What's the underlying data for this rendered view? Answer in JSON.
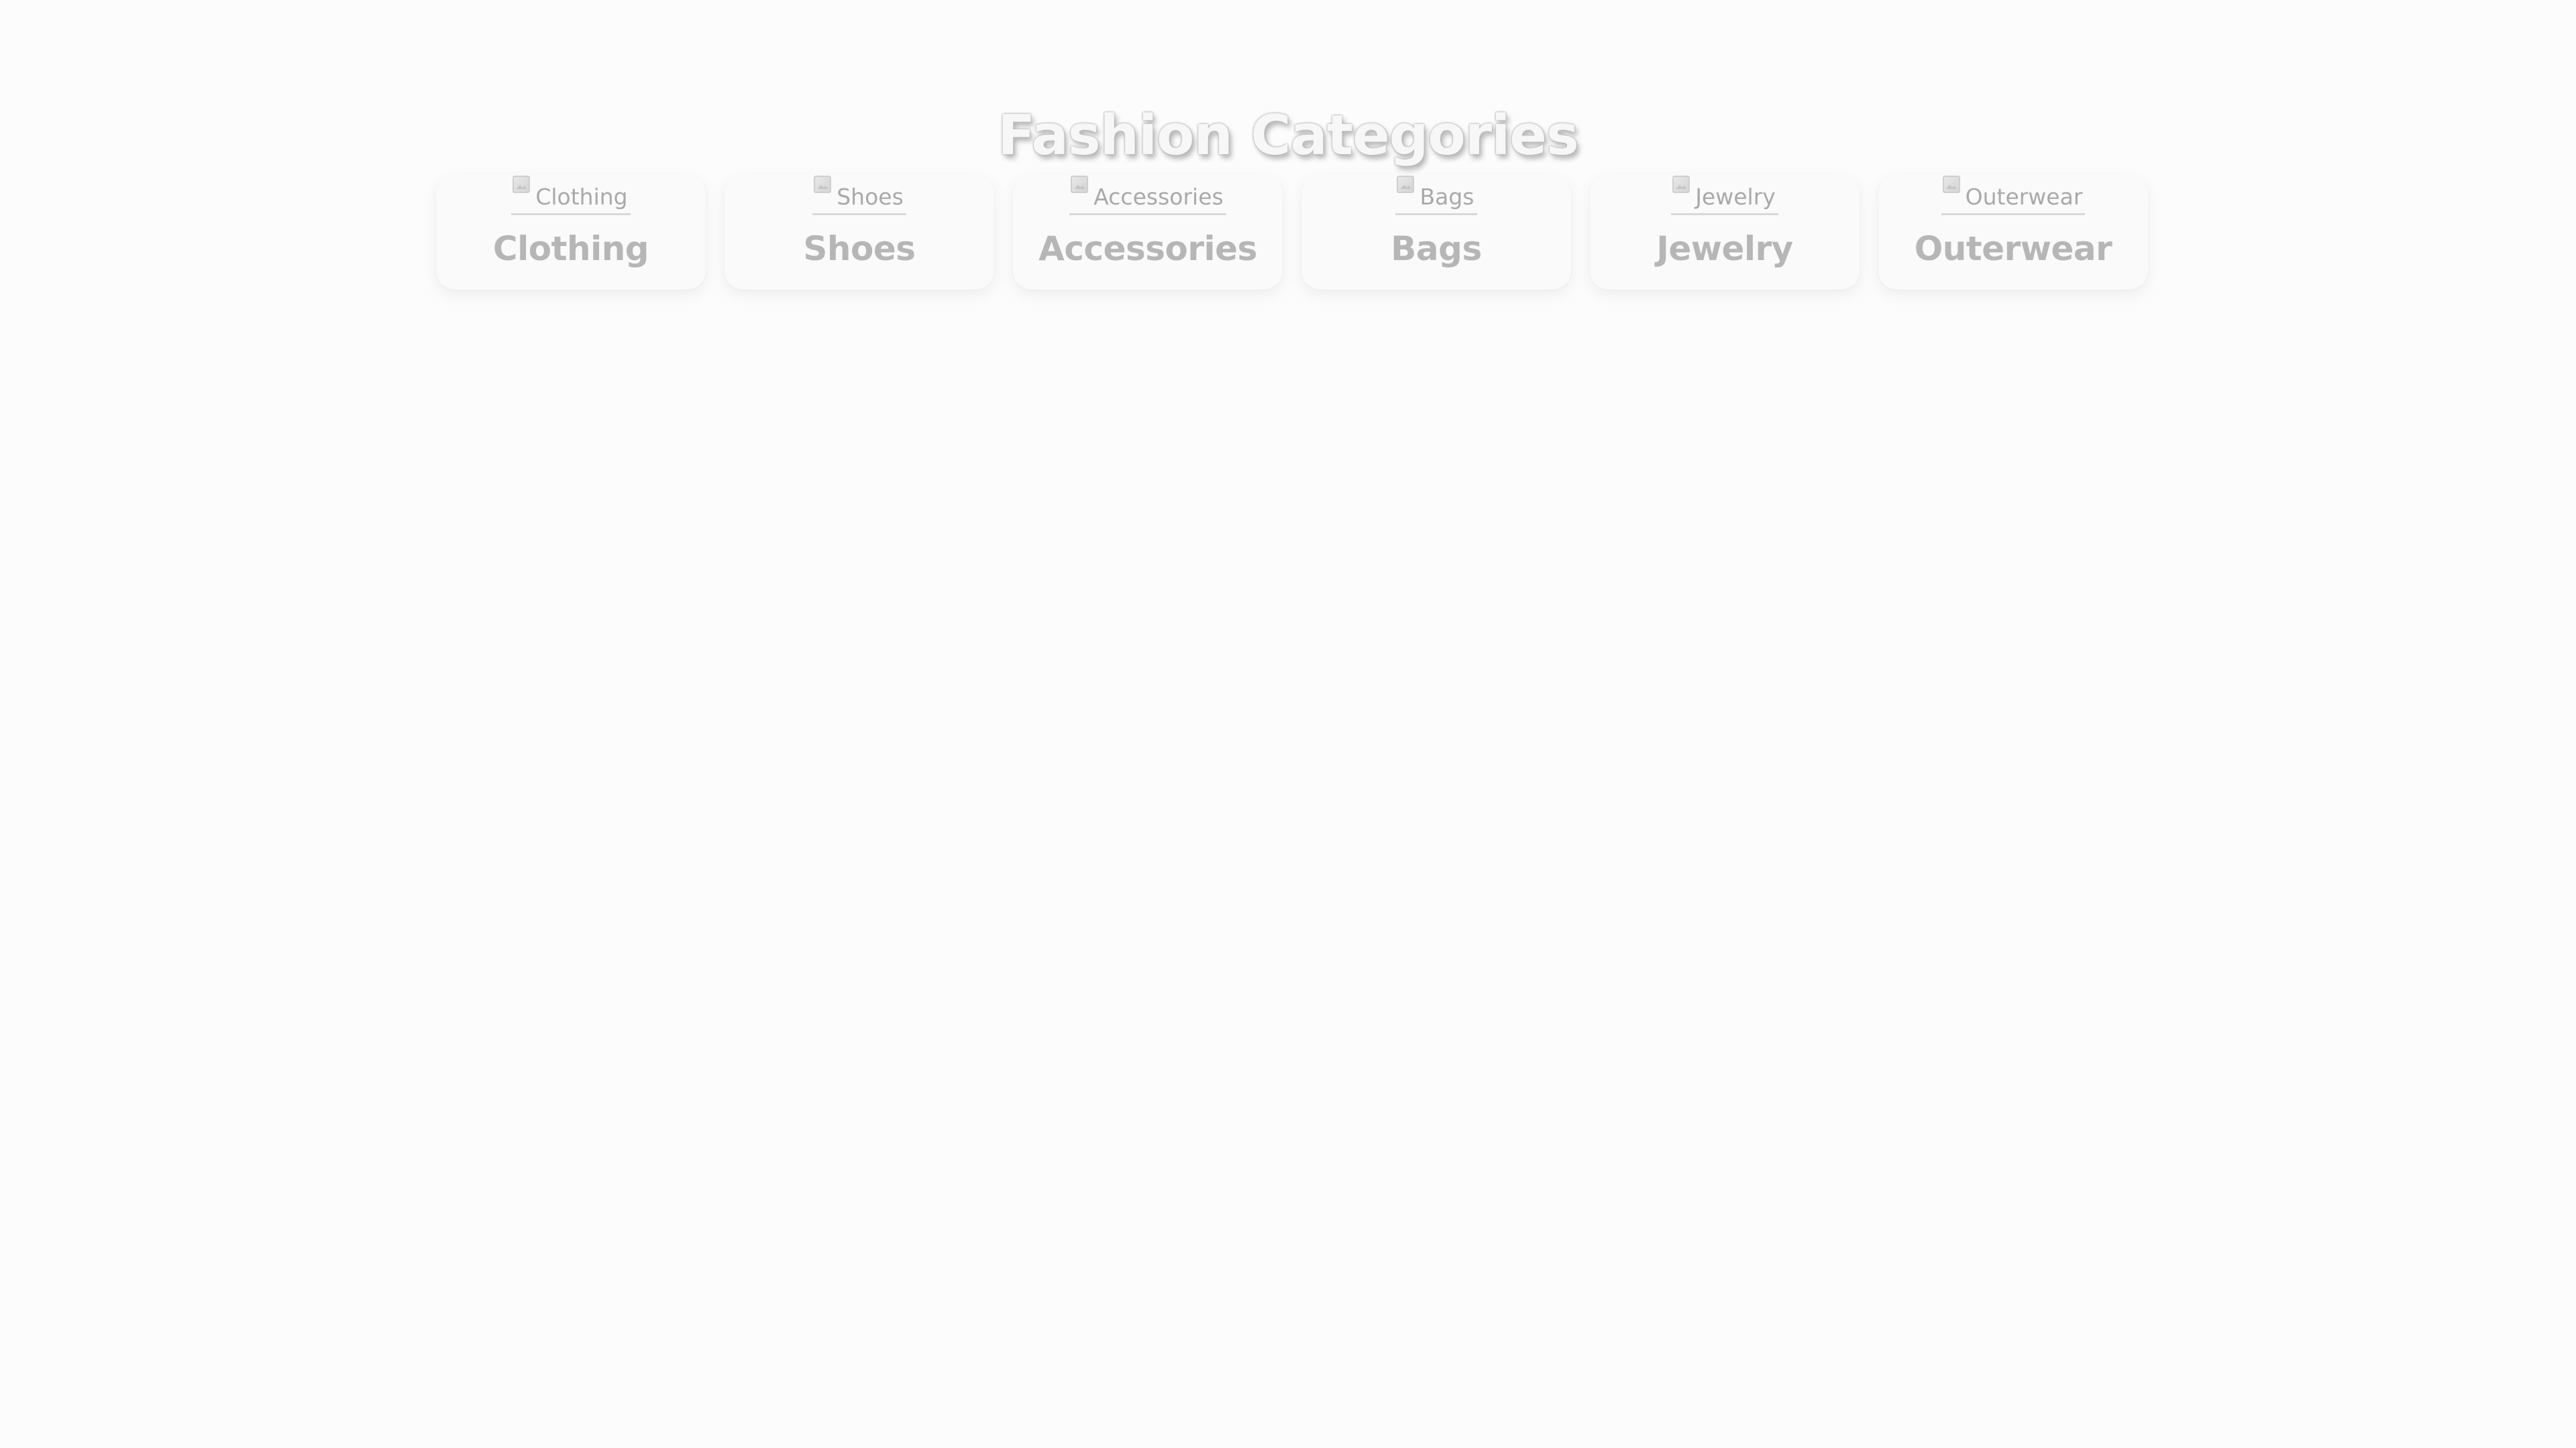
{
  "page": {
    "title": "Fashion Categories"
  },
  "categories": [
    {
      "name": "Clothing",
      "image_alt": "Clothing"
    },
    {
      "name": "Shoes",
      "image_alt": "Shoes"
    },
    {
      "name": "Accessories",
      "image_alt": "Accessories"
    },
    {
      "name": "Bags",
      "image_alt": "Bags"
    },
    {
      "name": "Jewelry",
      "image_alt": "Jewelry"
    },
    {
      "name": "Outerwear",
      "image_alt": "Outerwear"
    }
  ],
  "icons": {
    "category_image": "broken-image-icon"
  },
  "colors": {
    "background": "#fcfcfc",
    "card_background": "#fafafa",
    "label_text": "#b6b6b6",
    "title_fill": "#f7f7f7"
  }
}
